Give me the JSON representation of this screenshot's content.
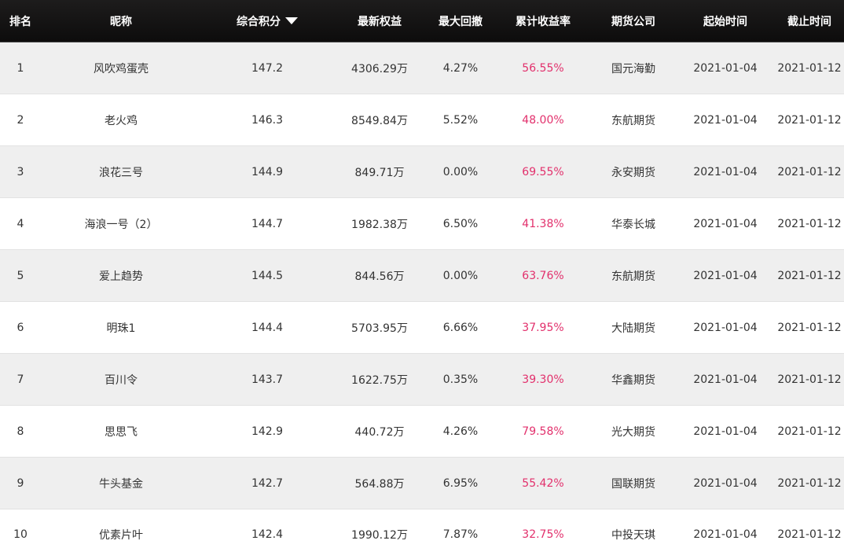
{
  "colors": {
    "header_bg": "#111010",
    "return_text": "#e2306c",
    "odd_row_bg": "#efefef",
    "even_row_bg": "#ffffff"
  },
  "header": {
    "rank": "排名",
    "name": "昵称",
    "score": "综合积分",
    "score_sort_icon": "sort-desc-icon",
    "equity": "最新权益",
    "drawdown": "最大回撤",
    "return": "累计收益率",
    "broker": "期货公司",
    "start": "起始时间",
    "end": "截止时间"
  },
  "rows": [
    {
      "rank": "1",
      "name": "风吹鸡蛋壳",
      "score": "147.2",
      "equity": "4306.29万",
      "drawdown": "4.27%",
      "return": "56.55%",
      "broker": "国元海勤",
      "start": "2021-01-04",
      "end": "2021-01-12"
    },
    {
      "rank": "2",
      "name": "老火鸡",
      "score": "146.3",
      "equity": "8549.84万",
      "drawdown": "5.52%",
      "return": "48.00%",
      "broker": "东航期货",
      "start": "2021-01-04",
      "end": "2021-01-12"
    },
    {
      "rank": "3",
      "name": "浪花三号",
      "score": "144.9",
      "equity": "849.71万",
      "drawdown": "0.00%",
      "return": "69.55%",
      "broker": "永安期货",
      "start": "2021-01-04",
      "end": "2021-01-12"
    },
    {
      "rank": "4",
      "name": "海浪一号（2）",
      "score": "144.7",
      "equity": "1982.38万",
      "drawdown": "6.50%",
      "return": "41.38%",
      "broker": "华泰长城",
      "start": "2021-01-04",
      "end": "2021-01-12"
    },
    {
      "rank": "5",
      "name": "爱上趋势",
      "score": "144.5",
      "equity": "844.56万",
      "drawdown": "0.00%",
      "return": "63.76%",
      "broker": "东航期货",
      "start": "2021-01-04",
      "end": "2021-01-12"
    },
    {
      "rank": "6",
      "name": "明珠1",
      "score": "144.4",
      "equity": "5703.95万",
      "drawdown": "6.66%",
      "return": "37.95%",
      "broker": "大陆期货",
      "start": "2021-01-04",
      "end": "2021-01-12"
    },
    {
      "rank": "7",
      "name": "百川令",
      "score": "143.7",
      "equity": "1622.75万",
      "drawdown": "0.35%",
      "return": "39.30%",
      "broker": "华鑫期货",
      "start": "2021-01-04",
      "end": "2021-01-12"
    },
    {
      "rank": "8",
      "name": "思思飞",
      "score": "142.9",
      "equity": "440.72万",
      "drawdown": "4.26%",
      "return": "79.58%",
      "broker": "光大期货",
      "start": "2021-01-04",
      "end": "2021-01-12"
    },
    {
      "rank": "9",
      "name": "牛头基金",
      "score": "142.7",
      "equity": "564.88万",
      "drawdown": "6.95%",
      "return": "55.42%",
      "broker": "国联期货",
      "start": "2021-01-04",
      "end": "2021-01-12"
    },
    {
      "rank": "10",
      "name": "优素片叶",
      "score": "142.4",
      "equity": "1990.12万",
      "drawdown": "7.87%",
      "return": "32.75%",
      "broker": "中投天琪",
      "start": "2021-01-04",
      "end": "2021-01-12"
    }
  ]
}
